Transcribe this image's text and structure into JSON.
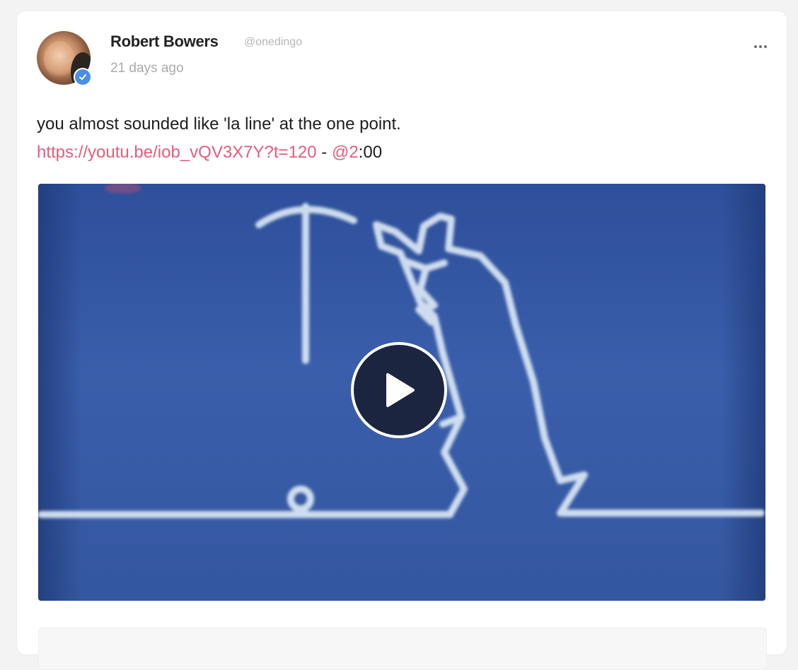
{
  "post": {
    "author_name": "Robert Bowers",
    "author_handle": "@onedingo",
    "timestamp": "21 days ago",
    "text_line1": "you almost sounded like 'la line' at the one point.",
    "link_url": "https://youtu.be/iob_vQV3X7Y?t=120",
    "separator": " - ",
    "mention": "@2",
    "mention_suffix": ":00"
  },
  "icons": {
    "more": "more-options-icon",
    "verified": "verified-badge-icon",
    "play": "play-icon"
  },
  "colors": {
    "link": "#e35d7b",
    "verified": "#4a90e2",
    "video_bg": "#3a5eab"
  }
}
